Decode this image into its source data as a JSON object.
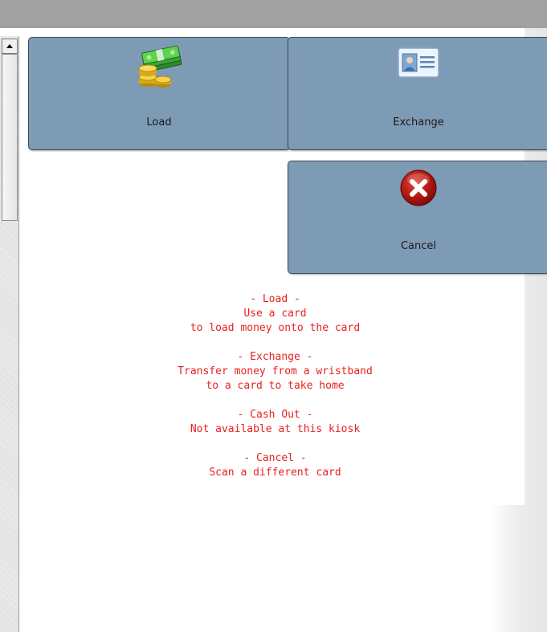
{
  "buttons": {
    "load": {
      "label": "Load",
      "icon": "money-stack-icon"
    },
    "exchange": {
      "label": "Exchange",
      "icon": "id-card-icon"
    },
    "cancel": {
      "label": "Cancel",
      "icon": "red-x-circle-icon"
    }
  },
  "info": [
    {
      "title": "- Load -",
      "lines": [
        "Use a card",
        "to load money onto the card"
      ]
    },
    {
      "title": "- Exchange -",
      "lines": [
        "Transfer money from a wristband",
        "to a card to take home"
      ]
    },
    {
      "title": "- Cash Out -",
      "lines": [
        "Not available at this kiosk"
      ]
    },
    {
      "title": "- Cancel -",
      "lines": [
        "Scan a different card"
      ]
    }
  ],
  "colors": {
    "button": "#7e9bb6",
    "info_text": "#e8211e",
    "top_bar": "#a1a1a1"
  }
}
